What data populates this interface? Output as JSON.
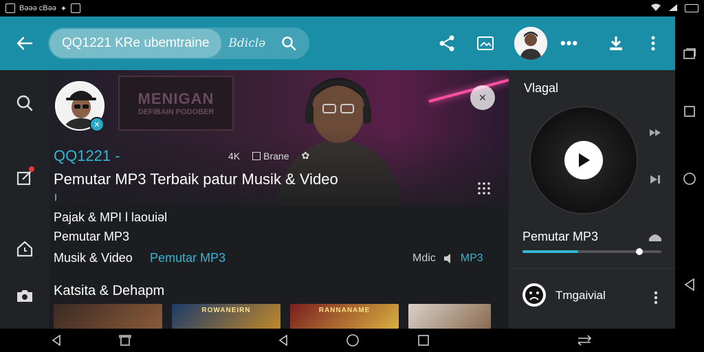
{
  "status_bar": {
    "left_text": "Bǝǝǝ cBǝǝ"
  },
  "toolbar": {
    "search_chip": "QQ1221 KRe ubemtraine",
    "search_suffix": "Bdiclǝ"
  },
  "hero": {
    "sign_line1": "MENIGAN",
    "sign_line2": "DEFIBAIN PODOBER",
    "channel": "QQ1221 -",
    "meta_a": "4K",
    "meta_b": "Brane",
    "title": "Pemutar MP3 Terbaik patur Musik & Video"
  },
  "details": {
    "line1": "Pajak & MPI Ɩ laouiǝl",
    "line2": "Pemutar MP3",
    "line3": "Musik & Video",
    "line3_link": "Pemutar MP3",
    "right_meta_1": "Mdic",
    "right_meta_2": "MP3"
  },
  "section": {
    "title": "Katsita & Dehapm",
    "thumbs": [
      {
        "label": "",
        "color_a": "#3b2a22",
        "color_b": "#8a5a3a"
      },
      {
        "label": "ROWANEIRN",
        "color_a": "#1c3a6a",
        "color_b": "#c0882a"
      },
      {
        "label": "RANNANAME",
        "color_a": "#7a1f1f",
        "color_b": "#d8b040"
      },
      {
        "label": "",
        "color_a": "#d9d2c8",
        "color_b": "#8a6a50"
      }
    ]
  },
  "panel": {
    "title": "Vlagal",
    "track_title": "Pemutar MP3",
    "progress": 0.4,
    "knob_position": 0.84,
    "user_name": "Tmgaivial"
  },
  "colors": {
    "accent": "#35b5d3",
    "toolbar": "#1b8ea7"
  }
}
